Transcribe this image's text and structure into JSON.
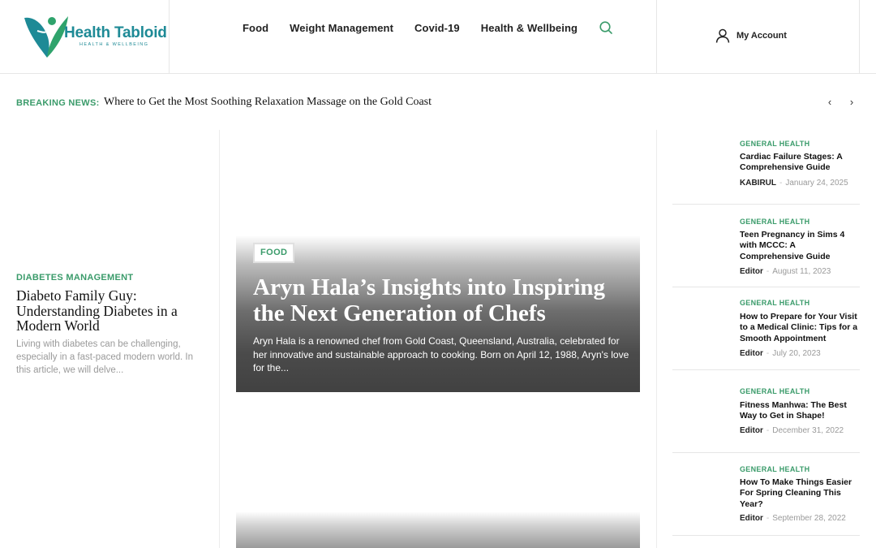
{
  "header": {
    "logo_title": "Health Tabloid",
    "logo_subtitle": "HEALTH & WELLBEING",
    "nav": [
      {
        "label": "Food"
      },
      {
        "label": "Weight Management"
      },
      {
        "label": "Covid-19"
      },
      {
        "label": "Health & Wellbeing"
      }
    ],
    "account_label": "My Account",
    "brand_color": "#1e8a96",
    "accent_color": "#3a9b6a"
  },
  "breaking": {
    "label": "BREAKING NEWS:",
    "headline": "Where to Get the Most Soothing Relaxation Massage on the Gold Coast"
  },
  "left_post": {
    "category": "DIABETES MANAGEMENT",
    "title": "Diabeto Family Guy: Understanding Diabetes in a Modern World",
    "excerpt": "Living with diabetes can be challenging, especially in a fast-paced modern world. In this article, we will delve..."
  },
  "feature": {
    "badge": "FOOD",
    "title": "Aryn Hala’s Insights into Inspiring the Next Generation of Chefs",
    "excerpt": "Aryn Hala is a renowned chef from Gold Coast, Queensland, Australia, celebrated for her innovative and sustainable approach to cooking. Born on April 12, 1988, Aryn's love for the..."
  },
  "sidebar_posts": [
    {
      "category": "GENERAL HEALTH",
      "title": "Cardiac Failure Stages: A Comprehensive Guide",
      "author": "KABIRUL",
      "date": "January 24, 2025"
    },
    {
      "category": "GENERAL HEALTH",
      "title": "Teen Pregnancy in Sims 4 with MCCC: A Comprehensive Guide",
      "author": "Editor",
      "date": "August 11, 2023"
    },
    {
      "category": "GENERAL HEALTH",
      "title": "How to Prepare for Your Visit to a Medical Clinic: Tips for a Smooth Appointment",
      "author": "Editor",
      "date": "July 20, 2023"
    },
    {
      "category": "GENERAL HEALTH",
      "title": "Fitness Manhwa: The Best Way to Get in Shape!",
      "author": "Editor",
      "date": "December 31, 2022"
    },
    {
      "category": "GENERAL HEALTH",
      "title": "How To Make Things Easier For Spring Cleaning This Year?",
      "author": "Editor",
      "date": "September 28, 2022"
    }
  ],
  "meta_separator": "-"
}
